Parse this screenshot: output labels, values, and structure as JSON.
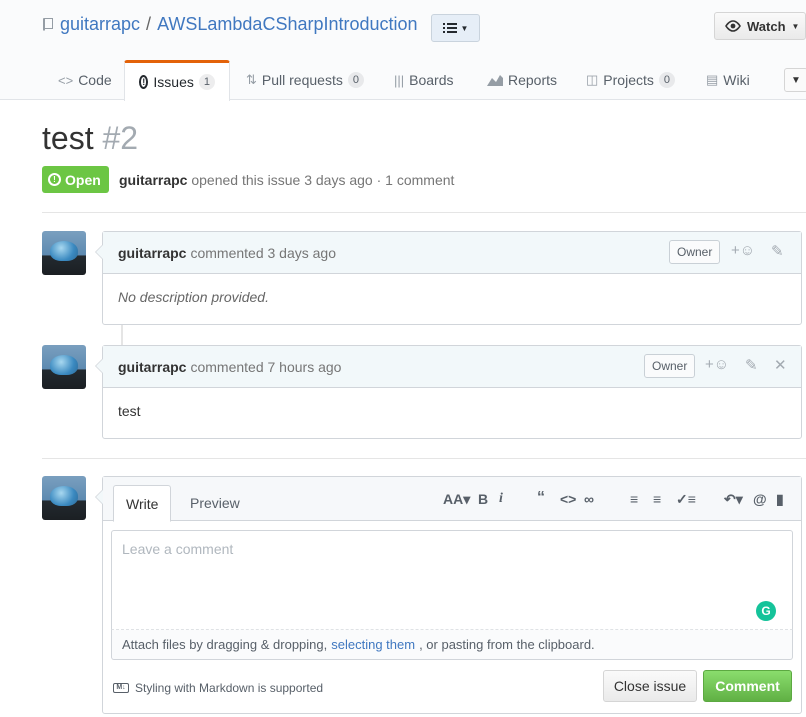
{
  "repo": {
    "owner": "guitarrapc",
    "separator": "/",
    "name": "AWSLambdaCSharpIntroduction"
  },
  "watch": {
    "label": "Watch"
  },
  "tabs": [
    {
      "icon": "code-icon",
      "label": "Code",
      "count": ""
    },
    {
      "icon": "issue-icon",
      "label": "Issues",
      "count": "1"
    },
    {
      "icon": "pull-request-icon",
      "label": "Pull requests",
      "count": "0"
    },
    {
      "icon": "boards-icon",
      "label": "Boards",
      "count": ""
    },
    {
      "icon": "reports-icon",
      "label": "Reports",
      "count": ""
    },
    {
      "icon": "projects-icon",
      "label": "Projects",
      "count": "0"
    },
    {
      "icon": "wiki-icon",
      "label": "Wiki",
      "count": ""
    }
  ],
  "issue": {
    "title": "test",
    "number": "#2",
    "state": "Open",
    "author": "guitarrapc",
    "meta": "opened this issue 3 days ago · 1 comment"
  },
  "comments": [
    {
      "author": "guitarrapc",
      "time": "commented 3 days ago",
      "badge": "Owner",
      "body": "No description provided."
    },
    {
      "author": "guitarrapc",
      "time": "commented 7 hours ago",
      "badge": "Owner",
      "body": "test"
    }
  ],
  "form": {
    "write_tab": "Write",
    "preview_tab": "Preview",
    "placeholder": "Leave a comment",
    "attach_prefix": "Attach files by dragging & dropping,",
    "attach_link": "selecting them",
    "attach_suffix": ", or pasting from the clipboard.",
    "markdown_note": "Styling with Markdown is supported",
    "close_label": "Close issue",
    "comment_label": "Comment"
  },
  "colors": {
    "link": "#4078c0",
    "open_green": "#6cc644",
    "tab_accent": "#e36209",
    "comment_green": "#60b044"
  }
}
